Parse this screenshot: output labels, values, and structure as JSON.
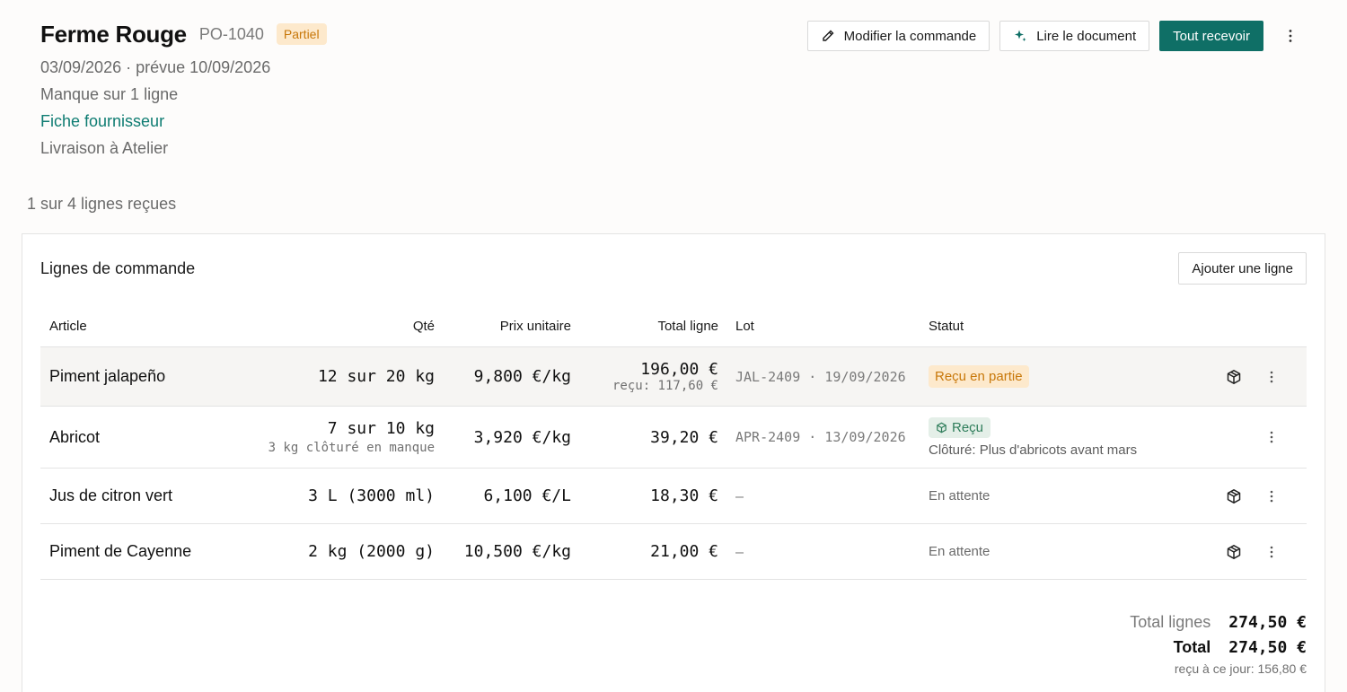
{
  "header": {
    "supplier": "Ferme Rouge",
    "po_number": "PO-1040",
    "status_badge": "Partiel",
    "dates": "03/09/2026 · prévue 10/09/2026",
    "shortage": "Manque sur 1 ligne",
    "supplier_link": "Fiche fournisseur",
    "delivery": "Livraison à Atelier"
  },
  "actions": {
    "edit_label": "Modifier la commande",
    "read_doc_label": "Lire le document",
    "receive_all_label": "Tout recevoir"
  },
  "summary": "1 sur 4 lignes reçues",
  "card": {
    "title": "Lignes de commande",
    "add_line_label": "Ajouter une ligne"
  },
  "columns": {
    "article": "Article",
    "qty": "Qté",
    "unit_price": "Prix unitaire",
    "line_total": "Total ligne",
    "lot": "Lot",
    "status": "Statut"
  },
  "rows": [
    {
      "article": "Piment jalapeño",
      "qty": "12 sur 20 kg",
      "unit_price": "9,800 €/kg",
      "total": "196,00 €",
      "total_sub": "reçu: 117,60 €",
      "lot": "JAL-2409 · 19/09/2026",
      "status": "Reçu en partie"
    },
    {
      "article": "Abricot",
      "qty": "7 sur 10 kg",
      "qty_sub": "3 kg clôturé en manque",
      "unit_price": "3,920 €/kg",
      "total": "39,20 €",
      "lot": "APR-2409 · 13/09/2026",
      "status": "Reçu",
      "status_note": "Clôturé: Plus d'abricots avant mars"
    },
    {
      "article": "Jus de citron vert",
      "qty": "3 L (3000 ml)",
      "unit_price": "6,100 €/L",
      "total": "18,30 €",
      "lot": "–",
      "status": "En attente"
    },
    {
      "article": "Piment de Cayenne",
      "qty": "2 kg (2000 g)",
      "unit_price": "10,500 €/kg",
      "total": "21,00 €",
      "lot": "–",
      "status": "En attente"
    }
  ],
  "totals": {
    "lines_label": "Total lignes",
    "lines_value": "274,50 €",
    "total_label": "Total",
    "total_value": "274,50 €",
    "received_to_date": "reçu à ce jour: 156,80 €"
  },
  "colors": {
    "accent": "#0f6f66",
    "partial_bg": "#fde9cc",
    "partial_text": "#c8780a",
    "received_bg": "#e4efe8",
    "received_text": "#2e7d5a"
  },
  "icons": [
    "pencil-icon",
    "sparkle-icon",
    "more-vertical-icon",
    "package-icon"
  ]
}
